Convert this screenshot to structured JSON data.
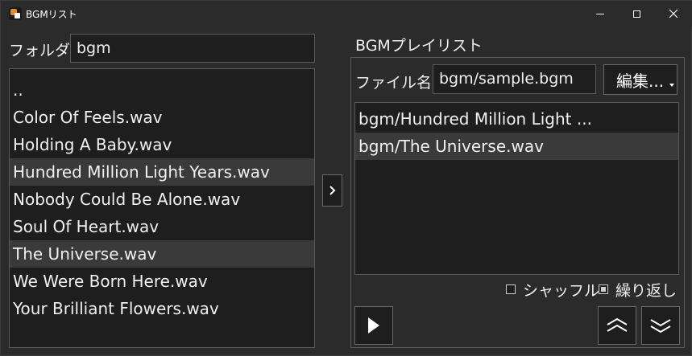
{
  "window": {
    "title": "BGMリスト",
    "colors": {
      "background": "#2b2b2b",
      "field": "#1e1e1e",
      "selection": "#3a3a3a",
      "border": "#5a5a5a"
    }
  },
  "folder": {
    "label": "フォルダ",
    "value": "bgm",
    "files": [
      {
        "name": "..",
        "selected": false
      },
      {
        "name": "Color Of Feels.wav",
        "selected": false
      },
      {
        "name": "Holding A Baby.wav",
        "selected": false
      },
      {
        "name": "Hundred Million Light Years.wav",
        "selected": true
      },
      {
        "name": "Nobody Could Be Alone.wav",
        "selected": false
      },
      {
        "name": "Soul Of Heart.wav",
        "selected": false
      },
      {
        "name": "The Universe.wav",
        "selected": true
      },
      {
        "name": "We Were Born Here.wav",
        "selected": false
      },
      {
        "name": "Your Brilliant Flowers.wav",
        "selected": false
      }
    ]
  },
  "add_button": {
    "icon": "chevron-right-icon"
  },
  "playlist": {
    "heading": "BGMプレイリスト",
    "file_label": "ファイル名",
    "file_value": "bgm/sample.bgm",
    "edit_label": "編集...",
    "items": [
      {
        "name": "bgm/Hundred Million Light ...",
        "selected": false
      },
      {
        "name": "bgm/The Universe.wav",
        "selected": true
      }
    ],
    "shuffle": {
      "label": "シャッフル",
      "checked": false
    },
    "repeat": {
      "label": "繰り返し",
      "checked": true
    }
  },
  "controls": {
    "play_icon": "play-icon",
    "up_icon": "double-chevron-up-icon",
    "down_icon": "double-chevron-down-icon"
  }
}
